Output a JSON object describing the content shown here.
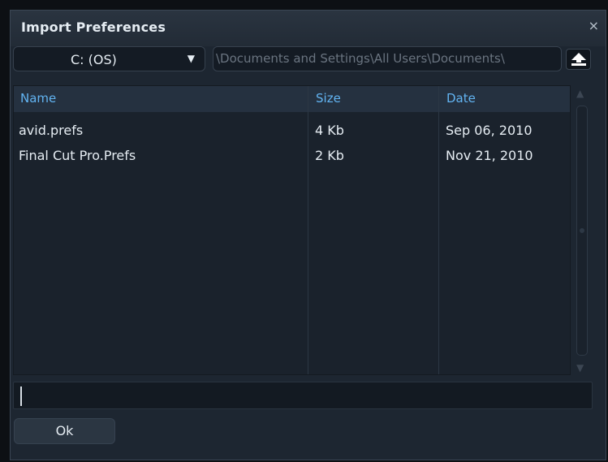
{
  "dialog": {
    "title": "Import Preferences",
    "close_glyph": "×"
  },
  "toolbar": {
    "drive_value": "C: (OS)",
    "drive_caret": "▼",
    "path_value": "\\Documents and Settings\\All Users\\Documents\\",
    "up_icon": "arrow-up-icon"
  },
  "table": {
    "columns": [
      "Name",
      "Size",
      "Date"
    ],
    "rows": [
      {
        "name": "avid.prefs",
        "size": "4 Kb",
        "date": "Sep 06, 2010"
      },
      {
        "name": "Final Cut Pro.Prefs",
        "size": "2 Kb",
        "date": "Nov 21, 2010"
      }
    ]
  },
  "scrollbar": {
    "up_glyph": "▲",
    "down_glyph": "▼"
  },
  "filename": {
    "value": ""
  },
  "actions": {
    "ok_label": "Ok"
  },
  "colors": {
    "header_text": "#62b4f2",
    "background": "#1d2631"
  }
}
